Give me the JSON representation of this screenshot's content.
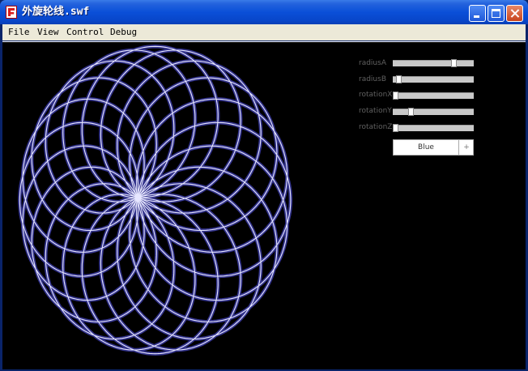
{
  "window": {
    "title": "外旋轮线.swf"
  },
  "menu": [
    "File",
    "View",
    "Control",
    "Debug"
  ],
  "controls": {
    "sliders": [
      {
        "label": "radiusA",
        "value": 0.77
      },
      {
        "label": "radiusB",
        "value": 0.04
      },
      {
        "label": "rotationX",
        "value": 0.0
      },
      {
        "label": "rotationY",
        "value": 0.2
      },
      {
        "label": "rotationZ",
        "value": 0.0
      }
    ],
    "color": {
      "selected": "Blue",
      "arrow": "+",
      "glow": "#5c5cff",
      "core": "#e6e6ff"
    }
  },
  "colors": {
    "stage": "#000000",
    "titlebar": "#0a4fd8",
    "menubar": "#ece9d8"
  }
}
